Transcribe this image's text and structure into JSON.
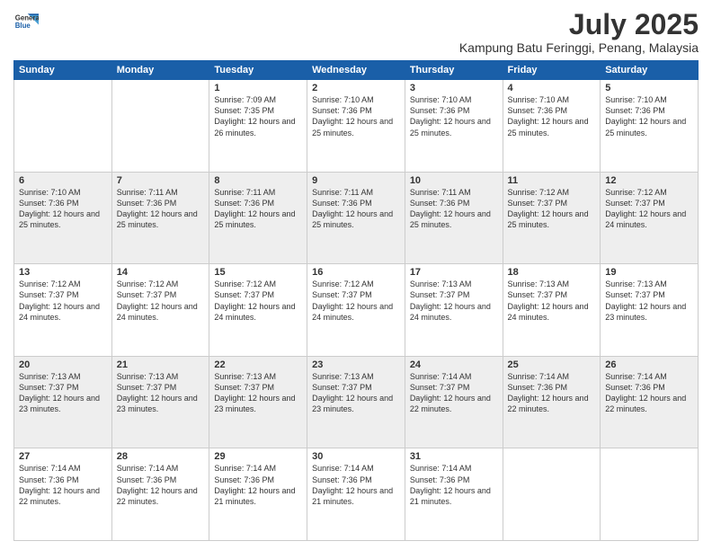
{
  "logo": {
    "line1": "General",
    "line2": "Blue"
  },
  "title": "July 2025",
  "subtitle": "Kampung Batu Feringgi, Penang, Malaysia",
  "days_header": [
    "Sunday",
    "Monday",
    "Tuesday",
    "Wednesday",
    "Thursday",
    "Friday",
    "Saturday"
  ],
  "weeks": [
    [
      {
        "day": "",
        "text": ""
      },
      {
        "day": "",
        "text": ""
      },
      {
        "day": "1",
        "text": "Sunrise: 7:09 AM\nSunset: 7:35 PM\nDaylight: 12 hours\nand 26 minutes."
      },
      {
        "day": "2",
        "text": "Sunrise: 7:10 AM\nSunset: 7:36 PM\nDaylight: 12 hours\nand 25 minutes."
      },
      {
        "day": "3",
        "text": "Sunrise: 7:10 AM\nSunset: 7:36 PM\nDaylight: 12 hours\nand 25 minutes."
      },
      {
        "day": "4",
        "text": "Sunrise: 7:10 AM\nSunset: 7:36 PM\nDaylight: 12 hours\nand 25 minutes."
      },
      {
        "day": "5",
        "text": "Sunrise: 7:10 AM\nSunset: 7:36 PM\nDaylight: 12 hours\nand 25 minutes."
      }
    ],
    [
      {
        "day": "6",
        "text": "Sunrise: 7:10 AM\nSunset: 7:36 PM\nDaylight: 12 hours\nand 25 minutes."
      },
      {
        "day": "7",
        "text": "Sunrise: 7:11 AM\nSunset: 7:36 PM\nDaylight: 12 hours\nand 25 minutes."
      },
      {
        "day": "8",
        "text": "Sunrise: 7:11 AM\nSunset: 7:36 PM\nDaylight: 12 hours\nand 25 minutes."
      },
      {
        "day": "9",
        "text": "Sunrise: 7:11 AM\nSunset: 7:36 PM\nDaylight: 12 hours\nand 25 minutes."
      },
      {
        "day": "10",
        "text": "Sunrise: 7:11 AM\nSunset: 7:36 PM\nDaylight: 12 hours\nand 25 minutes."
      },
      {
        "day": "11",
        "text": "Sunrise: 7:12 AM\nSunset: 7:37 PM\nDaylight: 12 hours\nand 25 minutes."
      },
      {
        "day": "12",
        "text": "Sunrise: 7:12 AM\nSunset: 7:37 PM\nDaylight: 12 hours\nand 24 minutes."
      }
    ],
    [
      {
        "day": "13",
        "text": "Sunrise: 7:12 AM\nSunset: 7:37 PM\nDaylight: 12 hours\nand 24 minutes."
      },
      {
        "day": "14",
        "text": "Sunrise: 7:12 AM\nSunset: 7:37 PM\nDaylight: 12 hours\nand 24 minutes."
      },
      {
        "day": "15",
        "text": "Sunrise: 7:12 AM\nSunset: 7:37 PM\nDaylight: 12 hours\nand 24 minutes."
      },
      {
        "day": "16",
        "text": "Sunrise: 7:12 AM\nSunset: 7:37 PM\nDaylight: 12 hours\nand 24 minutes."
      },
      {
        "day": "17",
        "text": "Sunrise: 7:13 AM\nSunset: 7:37 PM\nDaylight: 12 hours\nand 24 minutes."
      },
      {
        "day": "18",
        "text": "Sunrise: 7:13 AM\nSunset: 7:37 PM\nDaylight: 12 hours\nand 24 minutes."
      },
      {
        "day": "19",
        "text": "Sunrise: 7:13 AM\nSunset: 7:37 PM\nDaylight: 12 hours\nand 23 minutes."
      }
    ],
    [
      {
        "day": "20",
        "text": "Sunrise: 7:13 AM\nSunset: 7:37 PM\nDaylight: 12 hours\nand 23 minutes."
      },
      {
        "day": "21",
        "text": "Sunrise: 7:13 AM\nSunset: 7:37 PM\nDaylight: 12 hours\nand 23 minutes."
      },
      {
        "day": "22",
        "text": "Sunrise: 7:13 AM\nSunset: 7:37 PM\nDaylight: 12 hours\nand 23 minutes."
      },
      {
        "day": "23",
        "text": "Sunrise: 7:13 AM\nSunset: 7:37 PM\nDaylight: 12 hours\nand 23 minutes."
      },
      {
        "day": "24",
        "text": "Sunrise: 7:14 AM\nSunset: 7:37 PM\nDaylight: 12 hours\nand 22 minutes."
      },
      {
        "day": "25",
        "text": "Sunrise: 7:14 AM\nSunset: 7:36 PM\nDaylight: 12 hours\nand 22 minutes."
      },
      {
        "day": "26",
        "text": "Sunrise: 7:14 AM\nSunset: 7:36 PM\nDaylight: 12 hours\nand 22 minutes."
      }
    ],
    [
      {
        "day": "27",
        "text": "Sunrise: 7:14 AM\nSunset: 7:36 PM\nDaylight: 12 hours\nand 22 minutes."
      },
      {
        "day": "28",
        "text": "Sunrise: 7:14 AM\nSunset: 7:36 PM\nDaylight: 12 hours\nand 22 minutes."
      },
      {
        "day": "29",
        "text": "Sunrise: 7:14 AM\nSunset: 7:36 PM\nDaylight: 12 hours\nand 21 minutes."
      },
      {
        "day": "30",
        "text": "Sunrise: 7:14 AM\nSunset: 7:36 PM\nDaylight: 12 hours\nand 21 minutes."
      },
      {
        "day": "31",
        "text": "Sunrise: 7:14 AM\nSunset: 7:36 PM\nDaylight: 12 hours\nand 21 minutes."
      },
      {
        "day": "",
        "text": ""
      },
      {
        "day": "",
        "text": ""
      }
    ]
  ]
}
